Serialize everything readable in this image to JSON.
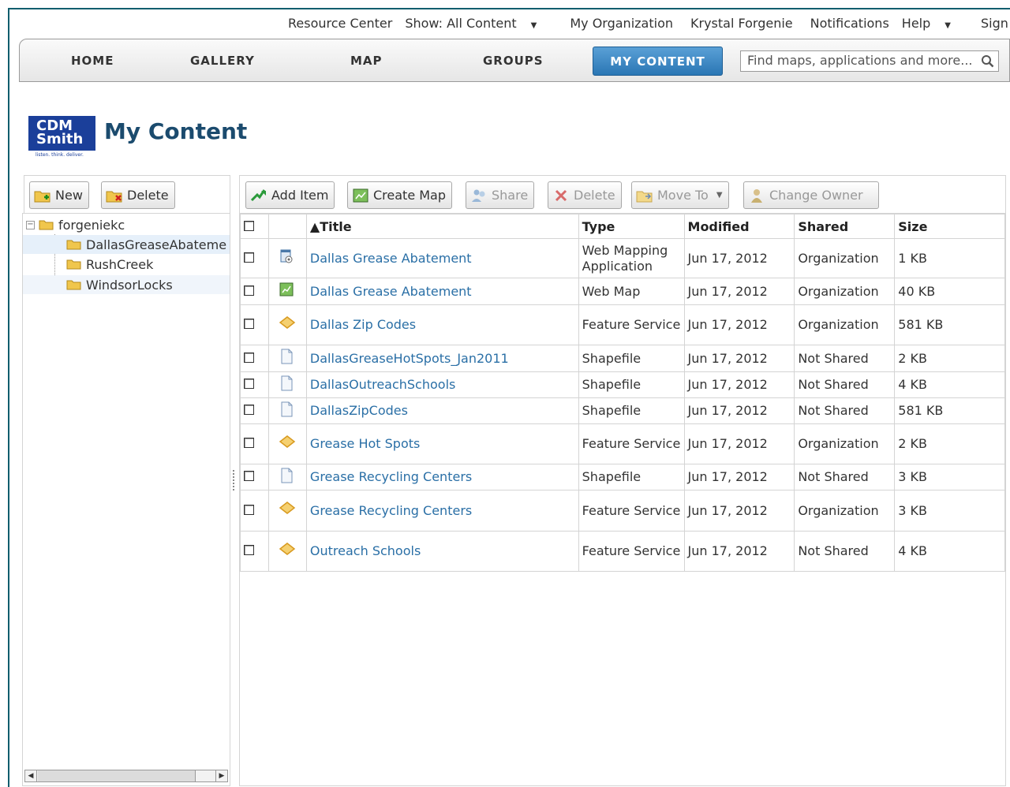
{
  "toplinks": {
    "resource_center": "Resource Center",
    "show_content": "Show: All Content",
    "my_organization": "My Organization",
    "user_name": "Krystal Forgenie",
    "notifications": "Notifications",
    "help": "Help",
    "sign_out": "Sign Out"
  },
  "nav": {
    "home": "HOME",
    "gallery": "GALLERY",
    "map": "MAP",
    "groups": "GROUPS",
    "my_content": "MY CONTENT",
    "search_placeholder": "Find maps, applications and more..."
  },
  "header": {
    "logo_line1": "CDM",
    "logo_line2": "Smith",
    "logo_tagline": "listen. think. deliver.",
    "title": "My Content"
  },
  "left_toolbar": {
    "new_label": "New",
    "delete_label": "Delete"
  },
  "tree": {
    "root": "forgeniekc",
    "folders": [
      {
        "label": "DallasGreaseAbateme",
        "selected": true
      },
      {
        "label": "RushCreek",
        "selected": false
      },
      {
        "label": "WindsorLocks",
        "selected": false
      }
    ]
  },
  "right_toolbar": {
    "add_item": "Add Item",
    "create_map": "Create Map",
    "share": "Share",
    "delete": "Delete",
    "move_to": "Move To",
    "change_owner": "Change Owner"
  },
  "table": {
    "columns": [
      "▲Title",
      "Type",
      "Modified",
      "Shared",
      "Size"
    ],
    "rows": [
      {
        "icon": "web-app",
        "title": "Dallas Grease Abatement",
        "type": "Web Mapping Application",
        "modified": "Jun 17, 2012",
        "shared": "Organization",
        "size": "1 KB"
      },
      {
        "icon": "web-map",
        "title": "Dallas Grease Abatement",
        "type": "Web Map",
        "modified": "Jun 17, 2012",
        "shared": "Organization",
        "size": "40 KB"
      },
      {
        "icon": "feature",
        "title": "Dallas Zip Codes",
        "type": "Feature Service",
        "modified": "Jun 17, 2012",
        "shared": "Organization",
        "size": "581 KB"
      },
      {
        "icon": "file",
        "title": "DallasGreaseHotSpots_Jan2011",
        "type": "Shapefile",
        "modified": "Jun 17, 2012",
        "shared": "Not Shared",
        "size": "2 KB"
      },
      {
        "icon": "file",
        "title": "DallasOutreachSchools",
        "type": "Shapefile",
        "modified": "Jun 17, 2012",
        "shared": "Not Shared",
        "size": "4 KB"
      },
      {
        "icon": "file",
        "title": "DallasZipCodes",
        "type": "Shapefile",
        "modified": "Jun 17, 2012",
        "shared": "Not Shared",
        "size": "581 KB"
      },
      {
        "icon": "feature",
        "title": "Grease Hot Spots",
        "type": "Feature Service",
        "modified": "Jun 17, 2012",
        "shared": "Organization",
        "size": "2 KB"
      },
      {
        "icon": "file",
        "title": "Grease Recycling Centers",
        "type": "Shapefile",
        "modified": "Jun 17, 2012",
        "shared": "Not Shared",
        "size": "3 KB"
      },
      {
        "icon": "feature",
        "title": "Grease Recycling Centers",
        "type": "Feature Service",
        "modified": "Jun 17, 2012",
        "shared": "Organization",
        "size": "3 KB"
      },
      {
        "icon": "feature",
        "title": "Outreach Schools",
        "type": "Feature Service",
        "modified": "Jun 17, 2012",
        "shared": "Not Shared",
        "size": "4 KB"
      }
    ]
  },
  "colors": {
    "accent": "#2a76b4",
    "link": "#2a6fa6",
    "frame": "#0f5e6e"
  }
}
